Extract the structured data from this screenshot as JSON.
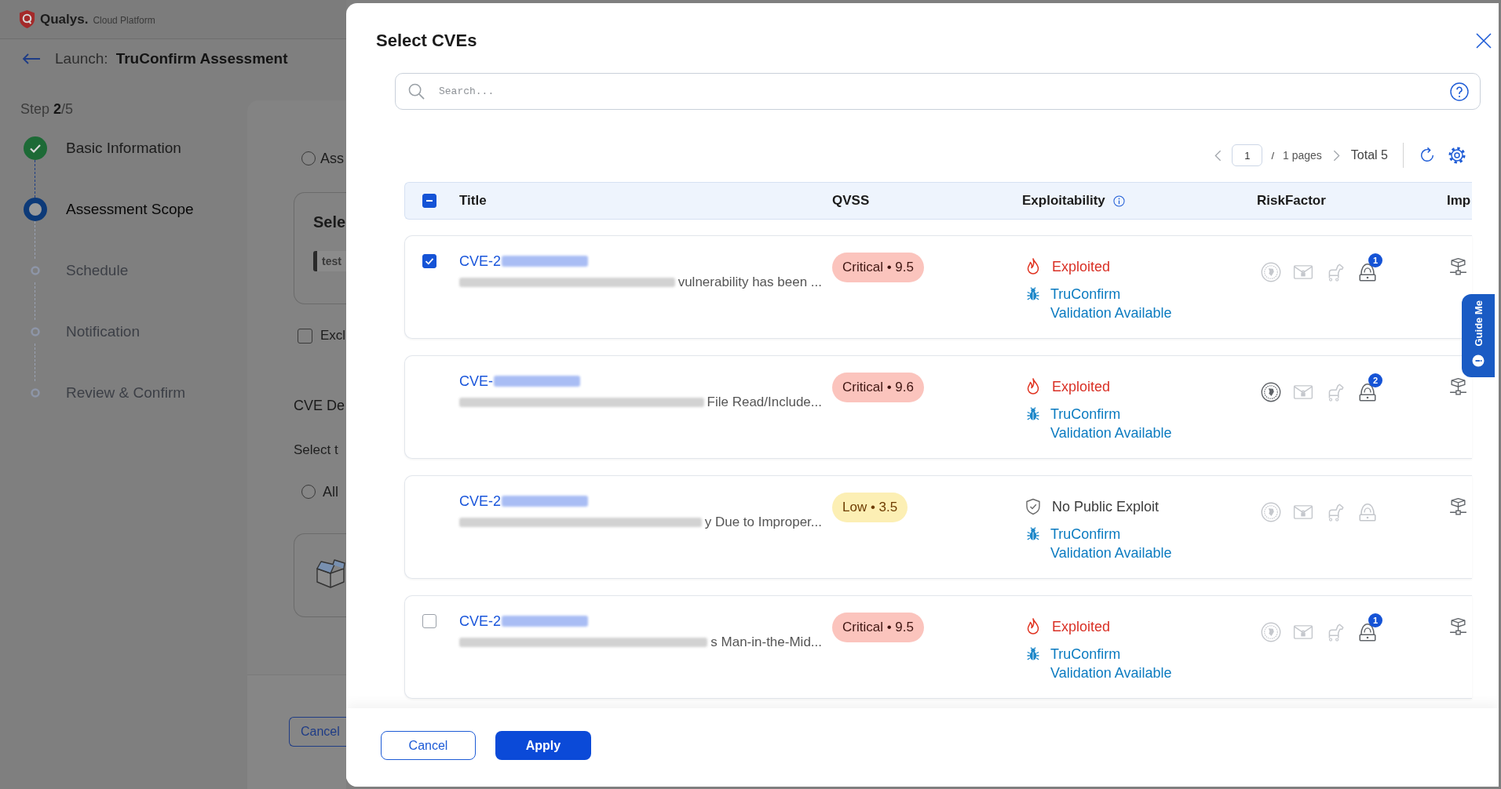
{
  "header": {
    "brand": "Qualys.",
    "product": "Cloud Platform"
  },
  "page": {
    "launch_label": "Launch:",
    "title": "TruConfirm Assessment"
  },
  "stepper": {
    "progress": "Step **2**/5",
    "steps": [
      {
        "label": "Basic Information",
        "completed": true,
        "selected": false
      },
      {
        "label": "Assessment Scope",
        "completed": false,
        "selected": true
      },
      {
        "label": "Schedule",
        "completed": false,
        "selected": false
      },
      {
        "label": "Notification",
        "completed": false,
        "selected": false
      },
      {
        "label": "Review & Confirm",
        "completed": false,
        "selected": false
      }
    ]
  },
  "scope_form": {
    "scope_option": {
      "label": "Ass",
      "selected": false
    },
    "selection_card": {
      "title": "Sele",
      "tag": "test"
    },
    "exclude_option": {
      "label": "Excl",
      "checked": false
    },
    "section_title": "CVE De",
    "prompt": "Select t",
    "cve_option": {
      "label": "All",
      "selected": false
    },
    "cancel_button": "Cancel"
  },
  "modal": {
    "title": "Select CVEs",
    "search": {
      "placeholder": "Search..."
    },
    "pagination": {
      "page": "1",
      "separator": "/",
      "pages": "1 pages",
      "total": "Total 5"
    },
    "table": {
      "select_all": {
        "indeterminate": true
      },
      "columns": [
        {
          "label": "Title"
        },
        {
          "label": "QVSS"
        },
        {
          "label": "Exploitability",
          "info": true
        },
        {
          "label": "RiskFactor"
        },
        {
          "label": "Imp"
        }
      ],
      "rows": [
        {
          "checkbox": {
            "checked": true
          },
          "cve": "CVE-2",
          "description": "vulnerability has been ...",
          "qvss": {
            "label": "Critical • 9.5",
            "kind": "critical"
          },
          "exploit": {
            "kind": "exploited",
            "label": "Exploited"
          },
          "validation": "TruConfirm Validation Available",
          "risk_factors": [
            {
              "kind": "seal",
              "active": false
            },
            {
              "kind": "mail",
              "active": false
            },
            {
              "kind": "horse",
              "active": false
            },
            {
              "kind": "actor",
              "active": true,
              "badge": "1"
            }
          ]
        },
        {
          "cve": "CVE-",
          "description": "File Read/Include...",
          "qvss": {
            "label": "Critical • 9.6",
            "kind": "critical"
          },
          "exploit": {
            "kind": "exploited",
            "label": "Exploited"
          },
          "validation": "TruConfirm Validation Available",
          "risk_factors": [
            {
              "kind": "seal",
              "active": true
            },
            {
              "kind": "mail",
              "active": false
            },
            {
              "kind": "horse",
              "active": false
            },
            {
              "kind": "actor",
              "active": true,
              "badge": "2"
            }
          ]
        },
        {
          "cve": "CVE-2",
          "description": "y Due to Improper...",
          "qvss": {
            "label": "Low • 3.5",
            "kind": "low"
          },
          "exploit": {
            "kind": "no_public_exploit",
            "label": "No Public Exploit"
          },
          "validation": "TruConfirm Validation Available",
          "risk_factors": [
            {
              "kind": "seal",
              "active": false
            },
            {
              "kind": "mail",
              "active": false
            },
            {
              "kind": "horse",
              "active": false
            },
            {
              "kind": "actor",
              "active": false
            }
          ]
        },
        {
          "checkbox": {
            "checked": false
          },
          "cve": "CVE-2",
          "description": "s Man-in-the-Mid...",
          "qvss": {
            "label": "Critical • 9.5",
            "kind": "critical"
          },
          "exploit": {
            "kind": "exploited",
            "label": "Exploited"
          },
          "validation": "TruConfirm Validation Available",
          "risk_factors": [
            {
              "kind": "seal",
              "active": false
            },
            {
              "kind": "mail",
              "active": false
            },
            {
              "kind": "horse",
              "active": false
            },
            {
              "kind": "actor",
              "active": true,
              "badge": "1"
            }
          ]
        }
      ]
    },
    "guide_tab": {
      "label": "Guide Me"
    },
    "buttons": [
      {
        "label": "Cancel",
        "kind": "secondary"
      },
      {
        "label": "Apply",
        "kind": "primary"
      }
    ]
  }
}
